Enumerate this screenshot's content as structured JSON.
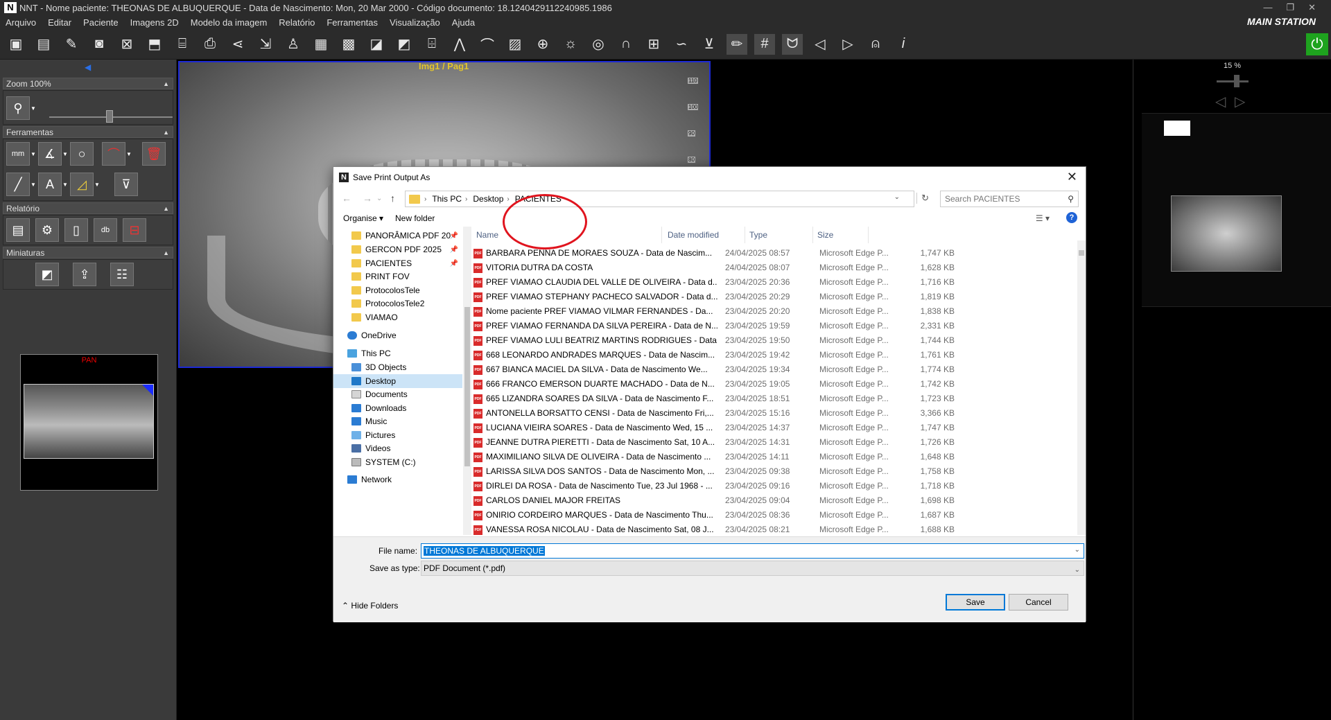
{
  "window": {
    "title": "NNT - Nome paciente: THEONAS DE ALBUQUERQUE - Data de Nascimento: Mon, 20 Mar 2000 - Código documento: 18.1240429112240985.1986",
    "logo": "N",
    "controls": [
      "—",
      "❐",
      "✕"
    ]
  },
  "menu": {
    "items": [
      "Arquivo",
      "Editar",
      "Paciente",
      "Imagens 2D",
      "Modelo da imagem",
      "Relatório",
      "Ferramentas",
      "Visualização",
      "Ajuda"
    ],
    "station": "MAIN STATION"
  },
  "toolbar": {
    "icons": [
      "save-icon",
      "save-as-icon",
      "edit-icon",
      "camera-icon",
      "close-image-icon",
      "import-icon",
      "scanner-icon",
      "print-icon",
      "share-icon",
      "export-icon",
      "patient-icon",
      "grid-icon",
      "grid-hide-icon",
      "image-delete-icon",
      "image-remove-icon",
      "acquire-icon",
      "implant-icon",
      "arc-icon",
      "image-view-icon",
      "crosshair-icon",
      "brightness-icon",
      "eye-hide-icon",
      "magnet-icon",
      "ruler-icon",
      "curve-icon",
      "tooth-tool-icon",
      "pencil-icon",
      "hash-icon",
      "teeth-icon",
      "prev-icon",
      "next-icon",
      "mouse-icon",
      "info-icon"
    ]
  },
  "left_panel": {
    "zoom_label": "Zoom 100%",
    "tools_label": "Ferramentas",
    "tool_mm": "mm",
    "tool_text": "A",
    "report_label": "Relatório",
    "report_db": "db",
    "thumbs_label": "Miniaturas",
    "thumb_title": "PAN"
  },
  "viewer": {
    "image_label": "Img1 / Pag1",
    "scale_ticks": [
      "110",
      "100",
      "90",
      "80"
    ]
  },
  "right_panel": {
    "zoom": "15 %"
  },
  "dialog": {
    "title": "Save Print Output As",
    "breadcrumb": [
      "This PC",
      "Desktop",
      "PACIENTES"
    ],
    "search_placeholder": "Search PACIENTES",
    "organise": "Organise ▾",
    "new_folder": "New folder",
    "nav": [
      {
        "label": "PANORÂMICA PDF 20",
        "icon": "folder",
        "pinned": true
      },
      {
        "label": "GERCON PDF 2025",
        "icon": "folder",
        "pinned": true
      },
      {
        "label": "PACIENTES",
        "icon": "folder",
        "pinned": true
      },
      {
        "label": "PRINT FOV",
        "icon": "folder",
        "pinned": false
      },
      {
        "label": "ProtocolosTele",
        "icon": "folder",
        "pinned": false
      },
      {
        "label": "ProtocolosTele2",
        "icon": "folder",
        "pinned": false
      },
      {
        "label": "VIAMAO",
        "icon": "folder",
        "pinned": false
      },
      {
        "label": "OneDrive",
        "icon": "cloud",
        "pinned": false
      },
      {
        "label": "This PC",
        "icon": "pc",
        "pinned": false
      },
      {
        "label": "3D Objects",
        "icon": "objects",
        "pinned": false
      },
      {
        "label": "Desktop",
        "icon": "desktop",
        "pinned": false
      },
      {
        "label": "Documents",
        "icon": "documents",
        "pinned": false
      },
      {
        "label": "Downloads",
        "icon": "downloads",
        "pinned": false
      },
      {
        "label": "Music",
        "icon": "music",
        "pinned": false
      },
      {
        "label": "Pictures",
        "icon": "pictures",
        "pinned": false
      },
      {
        "label": "Videos",
        "icon": "videos",
        "pinned": false
      },
      {
        "label": "SYSTEM (C:)",
        "icon": "drive",
        "pinned": false
      },
      {
        "label": "Network",
        "icon": "network",
        "pinned": false
      }
    ],
    "columns": [
      "Name",
      "Date modified",
      "Type",
      "Size"
    ],
    "files": [
      {
        "name": "BARBARA PENNA DE MORAES SOUZA - Data de Nascim...",
        "date": "24/04/2025 08:57",
        "type": "Microsoft Edge P...",
        "size": "1,747 KB"
      },
      {
        "name": "VITORIA DUTRA DA COSTA",
        "date": "24/04/2025 08:07",
        "type": "Microsoft Edge P...",
        "size": "1,628 KB"
      },
      {
        "name": "PREF VIAMAO CLAUDIA DEL VALLE DE OLIVEIRA - Data d...",
        "date": "23/04/2025 20:36",
        "type": "Microsoft Edge P...",
        "size": "1,716 KB"
      },
      {
        "name": "PREF VIAMAO STEPHANY PACHECO SALVADOR - Data d...",
        "date": "23/04/2025 20:29",
        "type": "Microsoft Edge P...",
        "size": "1,819 KB"
      },
      {
        "name": "Nome paciente PREF VIAMAO VILMAR FERNANDES - Da...",
        "date": "23/04/2025 20:20",
        "type": "Microsoft Edge P...",
        "size": "1,838 KB"
      },
      {
        "name": "PREF VIAMAO FERNANDA DA SILVA PEREIRA - Data de N...",
        "date": "23/04/2025 19:59",
        "type": "Microsoft Edge P...",
        "size": "2,331 KB"
      },
      {
        "name": "PREF VIAMAO LULI BEATRIZ MARTINS RODRIGUES - Data...",
        "date": "23/04/2025 19:50",
        "type": "Microsoft Edge P...",
        "size": "1,744 KB"
      },
      {
        "name": "668 LEONARDO ANDRADES MARQUES - Data de Nascim...",
        "date": "23/04/2025 19:42",
        "type": "Microsoft Edge P...",
        "size": "1,761 KB"
      },
      {
        "name": "667 BIANCA MACIEL DA SILVA - Data de Nascimento We...",
        "date": "23/04/2025 19:34",
        "type": "Microsoft Edge P...",
        "size": "1,774 KB"
      },
      {
        "name": "666 FRANCO EMERSON DUARTE MACHADO - Data de N...",
        "date": "23/04/2025 19:05",
        "type": "Microsoft Edge P...",
        "size": "1,742 KB"
      },
      {
        "name": "665 LIZANDRA SOARES DA SILVA - Data de Nascimento F...",
        "date": "23/04/2025 18:51",
        "type": "Microsoft Edge P...",
        "size": "1,723 KB"
      },
      {
        "name": "ANTONELLA BORSATTO CENSI - Data de Nascimento Fri,...",
        "date": "23/04/2025 15:16",
        "type": "Microsoft Edge P...",
        "size": "3,366 KB"
      },
      {
        "name": "LUCIANA VIEIRA SOARES - Data de Nascimento Wed, 15 ...",
        "date": "23/04/2025 14:37",
        "type": "Microsoft Edge P...",
        "size": "1,747 KB"
      },
      {
        "name": "JEANNE DUTRA PIERETTI - Data de Nascimento Sat, 10 A...",
        "date": "23/04/2025 14:31",
        "type": "Microsoft Edge P...",
        "size": "1,726 KB"
      },
      {
        "name": "MAXIMILIANO SILVA DE OLIVEIRA - Data de Nascimento ...",
        "date": "23/04/2025 14:11",
        "type": "Microsoft Edge P...",
        "size": "1,648 KB"
      },
      {
        "name": "LARISSA SILVA DOS SANTOS - Data de Nascimento Mon, ...",
        "date": "23/04/2025 09:38",
        "type": "Microsoft Edge P...",
        "size": "1,758 KB"
      },
      {
        "name": "DIRLEI DA ROSA - Data de Nascimento Tue, 23 Jul 1968 - ...",
        "date": "23/04/2025 09:16",
        "type": "Microsoft Edge P...",
        "size": "1,718 KB"
      },
      {
        "name": "CARLOS DANIEL MAJOR FREITAS",
        "date": "23/04/2025 09:04",
        "type": "Microsoft Edge P...",
        "size": "1,698 KB"
      },
      {
        "name": "ONIRIO CORDEIRO MARQUES - Data de Nascimento Thu...",
        "date": "23/04/2025 08:36",
        "type": "Microsoft Edge P...",
        "size": "1,687 KB"
      },
      {
        "name": "VANESSA ROSA NICOLAU - Data de Nascimento Sat, 08 J...",
        "date": "23/04/2025 08:21",
        "type": "Microsoft Edge P...",
        "size": "1,688 KB"
      }
    ],
    "file_name_label": "File name:",
    "file_name_value": "THEONAS DE ALBUQUERQUE",
    "save_type_label": "Save as type:",
    "save_type_value": "PDF Document (*.pdf)",
    "hide_folders": "Hide Folders",
    "save": "Save",
    "cancel": "Cancel",
    "colors": {
      "folder": "#f2c94c",
      "pdf": "#d92b2b",
      "accent": "#0078d7",
      "annotation": "#e0141e"
    }
  }
}
